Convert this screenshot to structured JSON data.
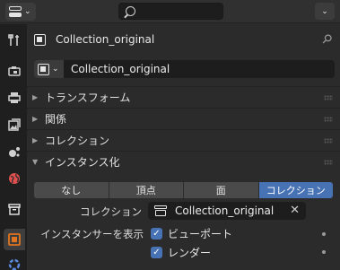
{
  "header": {
    "editor_type_icon": "properties-editor-icon",
    "search_placeholder": "",
    "options_label": "⌄"
  },
  "tabs": [
    {
      "name": "tool",
      "icon": "wrench-screwdriver-icon"
    },
    {
      "name": "render",
      "icon": "camera-back-icon"
    },
    {
      "name": "output",
      "icon": "printer-icon"
    },
    {
      "name": "view-layer",
      "icon": "images-icon"
    },
    {
      "name": "scene",
      "icon": "scene-icon"
    },
    {
      "name": "world",
      "icon": "world-icon"
    },
    {
      "name": "collection",
      "icon": "collection-box-icon"
    },
    {
      "name": "object",
      "icon": "object-square-icon",
      "active": true
    },
    {
      "name": "modifiers",
      "icon": "modifier-icon"
    }
  ],
  "context": {
    "name": "Collection_original"
  },
  "name_field": {
    "value": "Collection_original"
  },
  "sections": [
    {
      "label": "トランスフォーム",
      "expanded": false
    },
    {
      "label": "関係",
      "expanded": false
    },
    {
      "label": "コレクション",
      "expanded": false
    },
    {
      "label": "インスタンス化",
      "expanded": true
    }
  ],
  "instancing": {
    "options": [
      "なし",
      "頂点",
      "面",
      "コレクション"
    ],
    "selected_index": 3,
    "collection_label": "コレクション",
    "collection_value": "Collection_original",
    "show_instancer_label": "インスタンサーを表示",
    "viewport_label": "ビューポート",
    "viewport_checked": true,
    "render_label": "レンダー",
    "render_checked": true
  },
  "colors": {
    "accent": "#4772b3",
    "panel_bg": "#2b2b2b",
    "field_bg": "#1d1d1d",
    "collection_tab": "#e8e8e8",
    "object_tab": "#e07320",
    "world_tab": "#e05050",
    "modifier_tab": "#5a8ae0"
  }
}
